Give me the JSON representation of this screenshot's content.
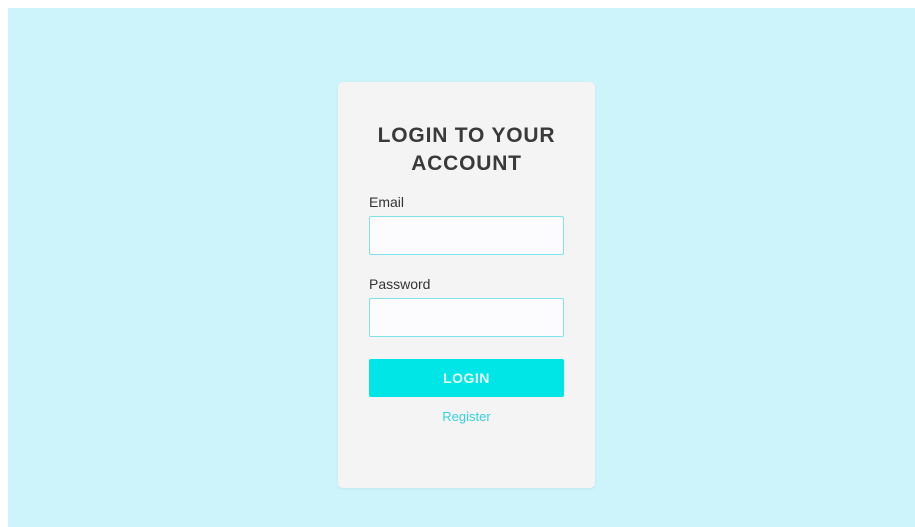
{
  "login_form": {
    "title_line1": "LOGIN TO YOUR",
    "title_line2": "ACCOUNT",
    "email_label": "Email",
    "email_value": "",
    "password_label": "Password",
    "password_value": "",
    "login_button_label": "LOGIN",
    "register_link_label": "Register"
  },
  "colors": {
    "page_background": "#cdf4fb",
    "card_background": "#f4f4f4",
    "accent": "#00e6e6",
    "link": "#38d0e0"
  }
}
